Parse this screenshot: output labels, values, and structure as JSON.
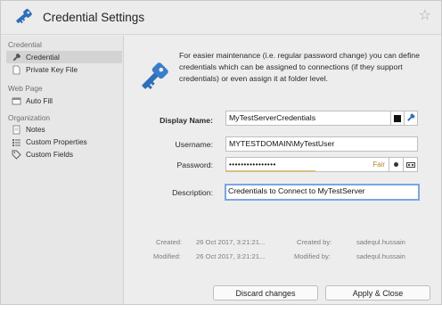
{
  "window": {
    "title": "Credential Settings"
  },
  "sidebar": {
    "sections": [
      {
        "title": "Credential",
        "items": [
          {
            "label": "Credential",
            "icon": "key-icon",
            "selected": true
          },
          {
            "label": "Private Key File",
            "icon": "document-icon",
            "selected": false
          }
        ]
      },
      {
        "title": "Web Page",
        "items": [
          {
            "label": "Auto Fill",
            "icon": "web-autofill-icon",
            "selected": false
          }
        ]
      },
      {
        "title": "Organization",
        "items": [
          {
            "label": "Notes",
            "icon": "notes-icon",
            "selected": false
          },
          {
            "label": "Custom Properties",
            "icon": "list-icon",
            "selected": false
          },
          {
            "label": "Custom Fields",
            "icon": "tag-icon",
            "selected": false
          }
        ]
      }
    ]
  },
  "main": {
    "info_text": "For easier maintenance (i.e. regular password change) you can define credentials which can be assigned to connections (if they support credentials) or even assign it at folder level.",
    "form": {
      "display_name": {
        "label": "Display Name:",
        "value": "MyTestServerCredentials"
      },
      "username": {
        "label": "Username:",
        "value": "MYTESTDOMAIN\\MyTestUser"
      },
      "password": {
        "label": "Password:",
        "value": "••••••••••••••••",
        "strength_label": "Fair"
      },
      "description": {
        "label": "Description:",
        "value": "Credentials to Connect to MyTestServer"
      }
    },
    "metadata": {
      "created_label": "Created:",
      "created_value": "26 Oct 2017, 3:21:21...",
      "modified_label": "Modified:",
      "modified_value": "26 Oct 2017, 3:21:21...",
      "created_by_label": "Created by:",
      "created_by_value": "sadequl.hussain",
      "modified_by_label": "Modified by:",
      "modified_by_value": "sadequl.hussain"
    }
  },
  "footer": {
    "discard_label": "Discard changes",
    "apply_label": "Apply & Close"
  },
  "colors": {
    "accent": "#2b6cb8",
    "focus_ring": "#7aa6e4",
    "strength_fair": "#e9c250"
  }
}
